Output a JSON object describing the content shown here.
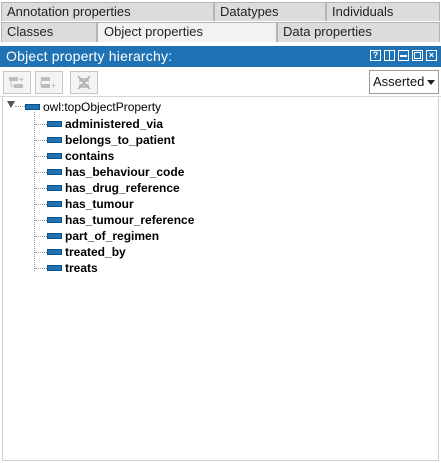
{
  "tabs_row1": [
    "Annotation properties",
    "Datatypes",
    "Individuals"
  ],
  "tabs_row2": [
    "Classes",
    "Object properties",
    "Data properties"
  ],
  "selected_tab": "Object properties",
  "panel": {
    "title": "Object property hierarchy:",
    "header_buttons": [
      "help-icon",
      "split-icon",
      "minimize-icon",
      "maximize-icon",
      "close-icon"
    ],
    "hierarchy_mode": "Asserted"
  },
  "toolbar": {
    "buttons": [
      "add-subproperty-icon",
      "add-sibling-property-icon",
      "delete-property-icon"
    ]
  },
  "tree": {
    "root": "owl:topObjectProperty",
    "children": [
      "administered_via",
      "belongs_to_patient",
      "contains",
      "has_behaviour_code",
      "has_drug_reference",
      "has_tumour",
      "has_tumour_reference",
      "part_of_regimen",
      "treated_by",
      "treats"
    ]
  },
  "colors": {
    "header": "#1f73b5",
    "property_icon": "#1f73b5"
  }
}
